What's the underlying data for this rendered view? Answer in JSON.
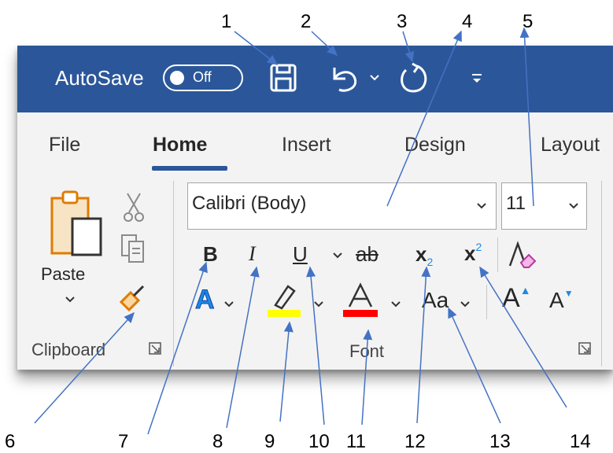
{
  "titlebar": {
    "autosave_label": "AutoSave",
    "autosave_state": "Off",
    "background": "#2b579a",
    "icons": [
      "save-icon",
      "undo-icon",
      "undo-dropdown-icon",
      "redo-icon",
      "customize-qat-icon"
    ]
  },
  "tabs": [
    {
      "label": "File",
      "active": false
    },
    {
      "label": "Home",
      "active": true
    },
    {
      "label": "Insert",
      "active": false
    },
    {
      "label": "Design",
      "active": false
    },
    {
      "label": "Layout",
      "active": false
    }
  ],
  "clipboard": {
    "paste_label": "Paste",
    "group_label": "Clipboard",
    "icons": [
      "paste-icon",
      "cut-icon",
      "copy-icon",
      "format-painter-icon",
      "dialog-launcher-icon"
    ]
  },
  "font": {
    "font_name": "Calibri (Body)",
    "font_size": "11",
    "group_label": "Font",
    "bold": "B",
    "italic": "I",
    "underline": "U",
    "strikethrough": "ab",
    "subscript_base": "x",
    "subscript_mark": "2",
    "superscript_base": "x",
    "superscript_mark": "2",
    "change_case": "Aa",
    "grow_font": "A",
    "shrink_font": "A",
    "highlight_color": "#ffff00",
    "font_color": "#ff0000",
    "text_effects_color": "#1e88e5"
  },
  "callouts": [
    "1",
    "2",
    "3",
    "4",
    "5",
    "6",
    "7",
    "8",
    "9",
    "10",
    "11",
    "12",
    "13",
    "14"
  ]
}
